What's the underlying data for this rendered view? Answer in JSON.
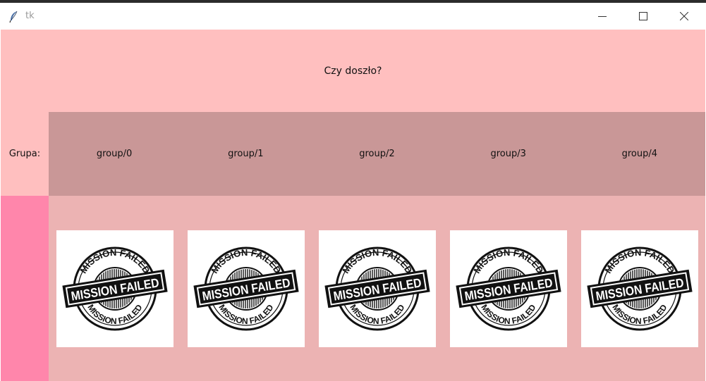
{
  "window": {
    "title": "tk",
    "minimize_icon": "minimize-icon",
    "maximize_icon": "maximize-icon",
    "close_icon": "close-icon",
    "app_icon": "feather-icon"
  },
  "header": {
    "question": "Czy doszło?"
  },
  "row_label": "Grupa:",
  "groups": [
    {
      "label": "group/0"
    },
    {
      "label": "group/1"
    },
    {
      "label": "group/2"
    },
    {
      "label": "group/3"
    },
    {
      "label": "group/4"
    }
  ],
  "images": [
    {
      "stamp_text": "MISSION FAILED"
    },
    {
      "stamp_text": "MISSION FAILED"
    },
    {
      "stamp_text": "MISSION FAILED"
    },
    {
      "stamp_text": "MISSION FAILED"
    },
    {
      "stamp_text": "MISSION FAILED"
    }
  ],
  "colors": {
    "header_bg": "#ffbfbf",
    "groups_bg": "#c99797",
    "left_strip_bg": "#ff86ab",
    "images_bg": "#ecb3b3"
  }
}
